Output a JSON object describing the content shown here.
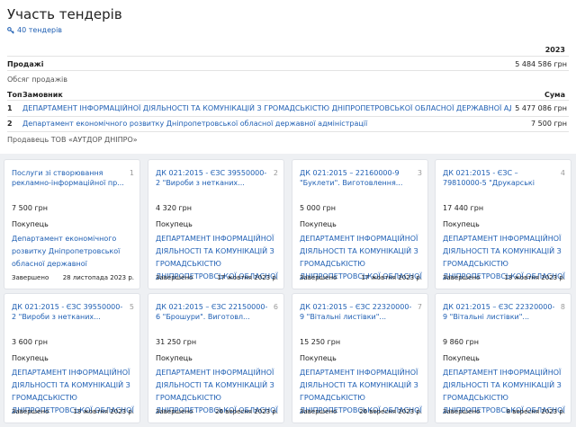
{
  "page": {
    "title": "Участь тендерів",
    "tender_count": "40 тендерів"
  },
  "summary": {
    "year": "2023",
    "sales_label": "Продажі",
    "sales_value": "5 484 586 грн",
    "volume_label": "Обсяг продажів",
    "headers": {
      "top": "Топ",
      "customer": "Замовник",
      "sum": "Сума"
    },
    "rows": [
      {
        "num": "1",
        "customer": "ДЕПАРТАМЕНТ ІНФОРМАЦІЙНОЇ ДІЯЛЬНОСТІ ТА КОМУНІКАЦІЙ З ГРОМАДСЬКІСТЮ ДНІПРОПЕТРОВСЬКОЇ ОБЛАСНОЇ ДЕРЖАВНОЇ АДМІНІСТРАЦІЇ",
        "sum": "5 477 086 грн"
      },
      {
        "num": "2",
        "customer": "Департамент економічного розвитку Дніпропетровської обласної державної адміністрації",
        "sum": "7 500 грн"
      }
    ],
    "seller": "Продавець ТОВ «АУТДОР ДНІПРО»"
  },
  "cards": [
    {
      "num": "1",
      "title": "Послуги зі створювання рекламно-інформаційної пр...",
      "price": "7 500 грн",
      "role": "Покупець",
      "buyer": "Департамент економічного розвитку Дніпропетровської обласної державної адміністрації",
      "status": "Завершено",
      "date": "28 листопада 2023 р."
    },
    {
      "num": "2",
      "title": "ДК 021:2015 - ЄЗС 39550000-2 \"Вироби з нетканих...",
      "price": "4 320 грн",
      "role": "Покупець",
      "buyer": "ДЕПАРТАМЕНТ ІНФОРМАЦІЙНОЇ ДІЯЛЬНОСТІ ТА КОМУНІКАЦІЙ З ГРОМАДСЬКІСТЮ ДНІПРОПЕТРОВСЬКОЇ ОБЛАСНОЇ ДЕРЖАВНОЇ АДМІНІСТРАЦІЇ",
      "status": "Завершено",
      "date": "17 жовтня 2023 р."
    },
    {
      "num": "3",
      "title": "ДК 021:2015 – 22160000-9 \"Буклети\". Виготовлення...",
      "price": "5 000 грн",
      "role": "Покупець",
      "buyer": "ДЕПАРТАМЕНТ ІНФОРМАЦІЙНОЇ ДІЯЛЬНОСТІ ТА КОМУНІКАЦІЙ З ГРОМАДСЬКІСТЮ ДНІПРОПЕТРОВСЬКОЇ ОБЛАСНОЇ ДЕРЖАВНОЇ АДМІНІСТРАЦІЇ",
      "status": "Завершено",
      "date": "17 жовтня 2023 р."
    },
    {
      "num": "4",
      "title": "ДК 021:2015 - ЄЗС – 79810000-5 \"Друкарські послуги...",
      "price": "17 440 грн",
      "role": "Покупець",
      "buyer": "ДЕПАРТАМЕНТ ІНФОРМАЦІЙНОЇ ДІЯЛЬНОСТІ ТА КОМУНІКАЦІЙ З ГРОМАДСЬКІСТЮ ДНІПРОПЕТРОВСЬКОЇ ОБЛАСНОЇ ДЕРЖАВНОЇ АДМІНІСТРАЦІЇ",
      "status": "Завершено",
      "date": "13 жовтня 2023 р."
    },
    {
      "num": "5",
      "title": "ДК 021:2015 - ЄЗС 39550000-2 \"Вироби з нетканих...",
      "price": "3 600 грн",
      "role": "Покупець",
      "buyer": "ДЕПАРТАМЕНТ ІНФОРМАЦІЙНОЇ ДІЯЛЬНОСТІ ТА КОМУНІКАЦІЙ З ГРОМАДСЬКІСТЮ ДНІПРОПЕТРОВСЬКОЇ ОБЛАСНОЇ ДЕРЖАВНОЇ АДМІНІСТРАЦІЇ",
      "status": "Завершено",
      "date": "13 жовтня 2023 р."
    },
    {
      "num": "6",
      "title": "ДК 021:2015 – ЄЗС 22150000-6 \"Брошури\". Виготовл...",
      "price": "31 250 грн",
      "role": "Покупець",
      "buyer": "ДЕПАРТАМЕНТ ІНФОРМАЦІЙНОЇ ДІЯЛЬНОСТІ ТА КОМУНІКАЦІЙ З ГРОМАДСЬКІСТЮ ДНІПРОПЕТРОВСЬКОЇ ОБЛАСНОЇ ДЕРЖАВНОЇ АДМІНІСТРАЦІЇ",
      "status": "Завершено",
      "date": "26 вересня 2023 р."
    },
    {
      "num": "7",
      "title": "ДК 021:2015 – ЄЗС 22320000-9 \"Вітальні листівки\"...",
      "price": "15 250 грн",
      "role": "Покупець",
      "buyer": "ДЕПАРТАМЕНТ ІНФОРМАЦІЙНОЇ ДІЯЛЬНОСТІ ТА КОМУНІКАЦІЙ З ГРОМАДСЬКІСТЮ ДНІПРОПЕТРОВСЬКОЇ ОБЛАСНОЇ ДЕРЖАВНОЇ АДМІНІСТРАЦІЇ",
      "status": "Завершено",
      "date": "26 вересня 2023 р."
    },
    {
      "num": "8",
      "title": "ДК 021:2015 – ЄЗС 22320000-9 \"Вітальні листівки\"...",
      "price": "9 860 грн",
      "role": "Покупець",
      "buyer": "ДЕПАРТАМЕНТ ІНФОРМАЦІЙНОЇ ДІЯЛЬНОСТІ ТА КОМУНІКАЦІЙ З ГРОМАДСЬКІСТЮ ДНІПРОПЕТРОВСЬКОЇ ОБЛАСНОЇ ДЕРЖАВНОЇ АДМІНІСТРАЦІЇ",
      "status": "Завершено",
      "date": "8 вересня 2023 р."
    }
  ]
}
